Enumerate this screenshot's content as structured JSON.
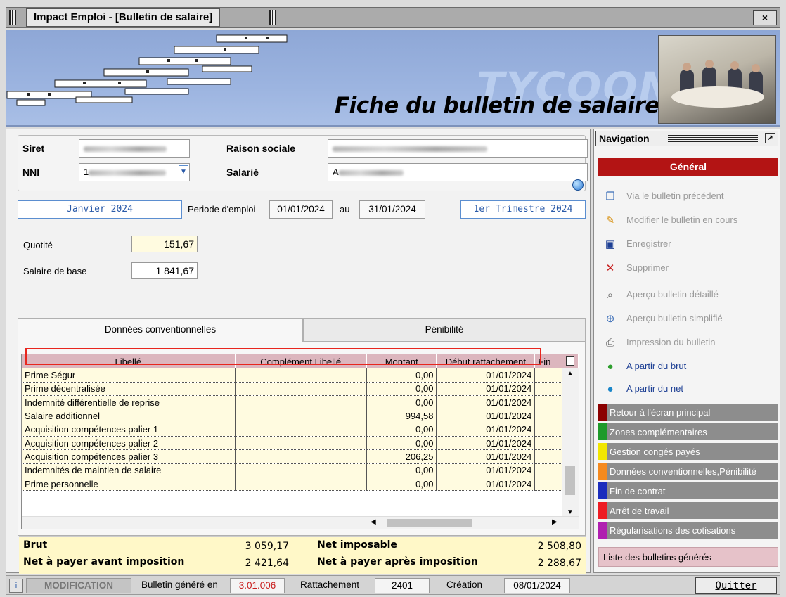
{
  "window": {
    "title": "Impact Emploi - [Bulletin de salaire]",
    "close_glyph": "×"
  },
  "banner": {
    "brand": "TYCOON",
    "title": "Fiche du bulletin de salaire"
  },
  "employer": {
    "siret_label": "Siret",
    "raison_sociale_label": "Raison sociale",
    "nni_label": "NNI",
    "nni_prefix": "1",
    "salarie_label": "Salarié",
    "salarie_prefix": "A"
  },
  "period": {
    "month": "Janvier 2024",
    "periode_label": "Periode d'emploi",
    "start": "01/01/2024",
    "au_label": "au",
    "end": "31/01/2024",
    "quarter": "1er Trimestre  2024"
  },
  "base": {
    "quotite_label": "Quotité",
    "quotite_value": "151,67",
    "salaire_label": "Salaire de base",
    "salaire_value": "1 841,67"
  },
  "tabs": [
    {
      "label": "Données conventionnelles"
    },
    {
      "label": "Pénibilité"
    }
  ],
  "grid": {
    "columns": [
      "Libellé",
      "Complément Libellé",
      "Montant",
      "Début rattachement",
      "Fin"
    ],
    "rows": [
      {
        "libelle": "Prime Ségur",
        "complement": "",
        "montant": "0,00",
        "debut": "01/01/2024"
      },
      {
        "libelle": "Prime décentralisée",
        "complement": "",
        "montant": "0,00",
        "debut": "01/01/2024"
      },
      {
        "libelle": "Indemnité différentielle de reprise",
        "complement": "",
        "montant": "0,00",
        "debut": "01/01/2024"
      },
      {
        "libelle": "Salaire additionnel",
        "complement": "",
        "montant": "994,58",
        "debut": "01/01/2024"
      },
      {
        "libelle": "Acquisition compétences palier 1",
        "complement": "",
        "montant": "0,00",
        "debut": "01/01/2024"
      },
      {
        "libelle": "Acquisition compétences palier 2",
        "complement": "",
        "montant": "0,00",
        "debut": "01/01/2024"
      },
      {
        "libelle": "Acquisition compétences palier 3",
        "complement": "",
        "montant": "206,25",
        "debut": "01/01/2024"
      },
      {
        "libelle": "Indemnités de maintien de salaire",
        "complement": "",
        "montant": "0,00",
        "debut": "01/01/2024"
      },
      {
        "libelle": "Prime personnelle",
        "complement": "",
        "montant": "0,00",
        "debut": "01/01/2024"
      }
    ]
  },
  "totals": {
    "brut_label": "Brut",
    "brut_value": "3 059,17",
    "net_imposable_label": "Net imposable",
    "net_imposable_value": "2 508,80",
    "net_avant_label": "Net à payer avant imposition",
    "net_avant_value": "2 421,64",
    "net_apres_label": "Net à payer après imposition",
    "net_apres_value": "2 288,67"
  },
  "navigation": {
    "title": "Navigation",
    "section": "Général",
    "items": [
      {
        "label": "Via le bulletin précédent",
        "icon": "document-icon",
        "enabled": false
      },
      {
        "label": "Modifier le bulletin en cours",
        "icon": "edit-icon",
        "enabled": false
      },
      {
        "label": "Enregistrer",
        "icon": "save-icon",
        "enabled": false
      },
      {
        "label": "Supprimer",
        "icon": "delete-icon",
        "enabled": false
      },
      {
        "label": "Aperçu bulletin détaillé",
        "icon": "preview-icon",
        "enabled": false
      },
      {
        "label": "Aperçu bulletin simplifié",
        "icon": "zoom-icon",
        "enabled": false
      },
      {
        "label": "Impression du bulletin",
        "icon": "printer-icon",
        "enabled": false
      },
      {
        "label": "A partir du brut",
        "icon": "green-circle-icon",
        "enabled": true
      },
      {
        "label": "A partir du net",
        "icon": "blue-circle-icon",
        "enabled": true
      }
    ],
    "buttons": [
      {
        "label": "Retour à l'écran principal",
        "color": "#8b0000"
      },
      {
        "label": "Zones complémentaires",
        "color": "#1f9a2a"
      },
      {
        "label": "Gestion congés payés",
        "color": "#f2e600"
      },
      {
        "label": "Données conventionnelles,Pénibilité",
        "color": "#f58a1f"
      },
      {
        "label": "Fin de contrat",
        "color": "#1b2dbd"
      },
      {
        "label": "Arrêt de travail",
        "color": "#ee1c24"
      },
      {
        "label": "Régularisations des cotisations",
        "color": "#b01fb0"
      }
    ],
    "liste": "Liste des bulletins générés"
  },
  "status": {
    "mode": "MODIFICATION",
    "genere_label": "Bulletin généré en",
    "genere_value": "3.01.006",
    "rattachement_label": "Rattachement",
    "rattachement_value": "2401",
    "creation_label": "Création",
    "creation_value": "08/01/2024",
    "quit_label": "Quitter"
  }
}
